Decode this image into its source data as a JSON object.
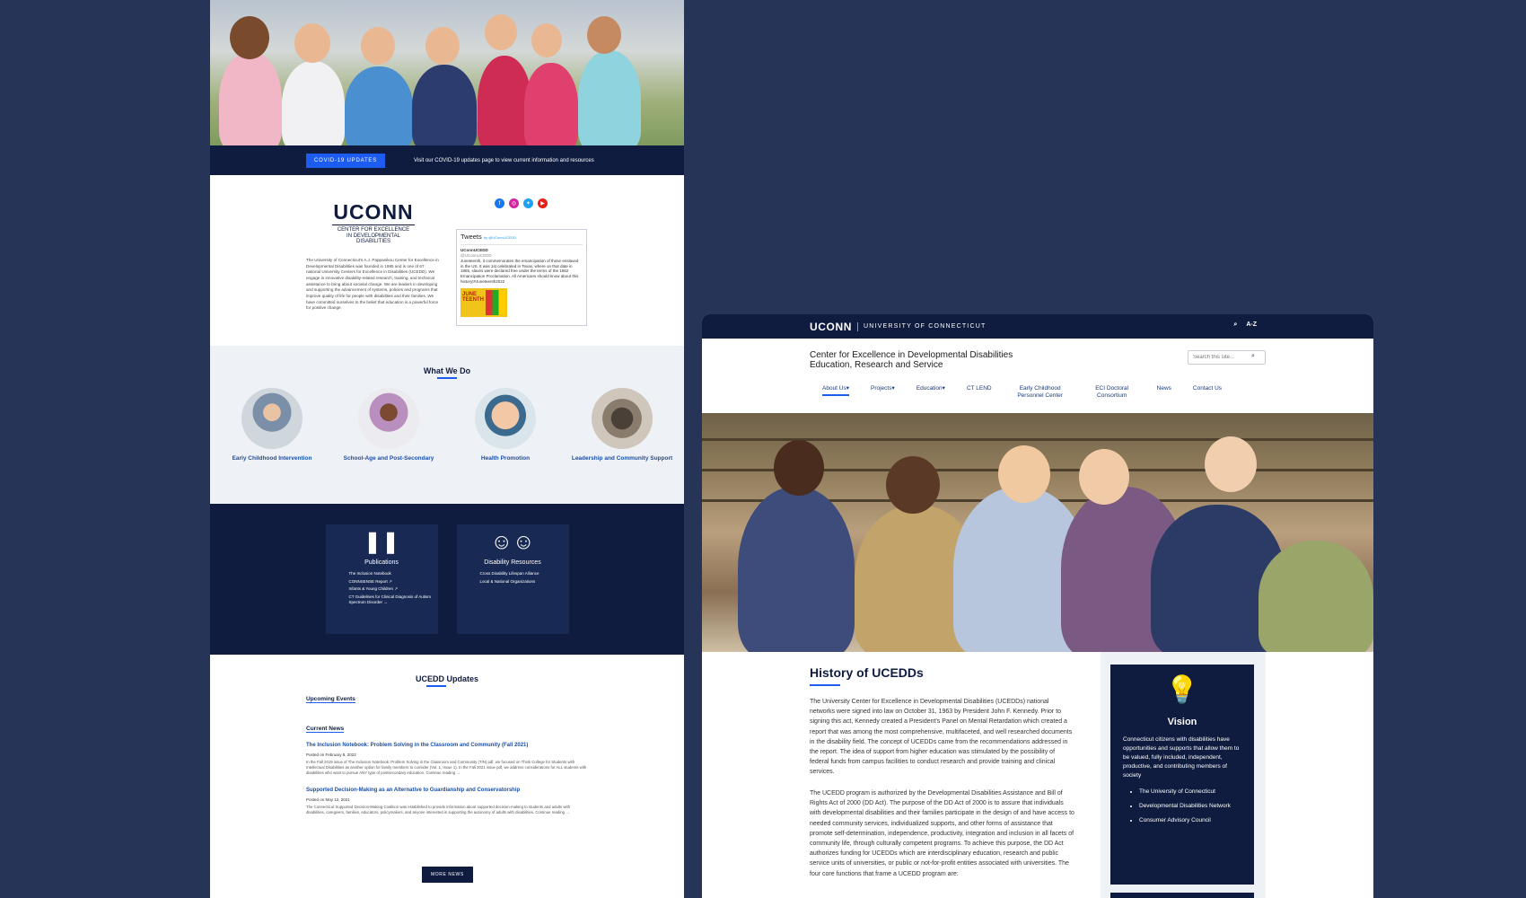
{
  "left_page": {
    "covid": {
      "button_label": "COVID-19 UPDATES",
      "text": "Visit our COVID-19 updates page to view current information and resources"
    },
    "logo": {
      "word": "UCONN",
      "subtitle_line1": "CENTER FOR EXCELLENCE",
      "subtitle_line2": "IN DEVELOPMENTAL",
      "subtitle_line3": "DISABILITIES"
    },
    "intro_text": "The University of Connecticut's A.J. Pappanikou Center for Excellence in Developmental Disabilities was founded in 1985 and is one of 67 national University Centers for Excellence in Disabilities (UCEDD). We engage in innovative disability-related research, training, and technical assistance to bring about societal change. We are leaders in developing and supporting the advancement of systems, policies and programs that improve quality of life for people with disabilities and their families. We have committed ourselves to the belief that education is a powerful force for positive change.",
    "social_icons": [
      "facebook-icon",
      "instagram-icon",
      "twitter-icon",
      "youtube-icon"
    ],
    "tweets": {
      "title": "Tweets",
      "by": "by @UConnUCEDD",
      "account": "UConnUCEDD",
      "handle": "@UConnUCEDD",
      "body": "Juneteenth, it commemorates the emancipation of those enslaved in the US. It was 1st celebrated in Texas, where on that date in 1865, slaves were declared free under the terms of the 1862 Emancipation Proclamation. All Americans should know about this history!#Juneteenth2022",
      "image_text": "JUNE TEENTH"
    },
    "what_we_do": {
      "title": "What We Do",
      "items": [
        {
          "label": "Early Childhood Intervention"
        },
        {
          "label": "School-Age and Post-Secondary"
        },
        {
          "label": "Health Promotion"
        },
        {
          "label": "Leadership and Community Support"
        }
      ]
    },
    "resources": [
      {
        "title": "Publications",
        "icon": "books-icon",
        "links": [
          "The Inclusion Notebook",
          "CONNSENSE Report ↗",
          "Infants & Young Children ↗",
          "CT Guidelines for Clinical Diagnosis of Autism Spectrum Disorder →"
        ]
      },
      {
        "title": "Disability Resources",
        "icon": "people-icon",
        "links": [
          "Cross Disability Lifespan Alliance",
          "Local & National Organizations"
        ]
      }
    ],
    "updates": {
      "title": "UCEDD Updates",
      "upcoming_label": "Upcoming Events",
      "current_label": "Current News",
      "news": [
        {
          "title": "The Inclusion Notebook: Problem Solving in the Classroom and Community (Fall 2021)",
          "date": "Posted on February 8, 2022",
          "body": "In the Fall 2019 issue of The Inclusion Notebook: Problem Solving in the Classroom and Community (TIN) pdf, we focused on Think College for Students with Intellectual Disabilities as another option for family members to consider (Vol. 1, Issue 1). In the Fall 2021 issue pdf, we address considerations for ALL students with disabilities who want to pursue ANY type of postsecondary education. Continue reading →"
        },
        {
          "title": "Supported Decision-Making as an Alternative to Guardianship and Conservatorship",
          "date": "Posted on May 12, 2021",
          "body": "The Connecticut Supported Decision-Making Coalition was established to provide information about supported decision-making to students and adults with disabilities, caregivers, families, educators, policymakers, and anyone interested in supporting the autonomy of adults with disabilities. Continue reading →"
        }
      ],
      "more_label": "MORE NEWS"
    }
  },
  "right_page": {
    "topbar": {
      "logo": "UCONN",
      "university": "UNIVERSITY OF CONNECTICUT",
      "search_icon": "search-icon",
      "az_label": "A-Z"
    },
    "site_title_line1": "Center for Excellence in Developmental Disabilities",
    "site_title_line2": "Education, Research and Service",
    "search_placeholder": "Search this site...",
    "nav": [
      {
        "label": "About Us▾",
        "active": true
      },
      {
        "label": "Projects▾"
      },
      {
        "label": "Education▾"
      },
      {
        "label": "CT LEND"
      },
      {
        "label": "Early Childhood Personnel Center"
      },
      {
        "label": "ECI Doctoral Consortium"
      },
      {
        "label": "News"
      },
      {
        "label": "Contact Us"
      }
    ],
    "history": {
      "title": "History of UCEDDs",
      "p1": "The University Center for Excellence in Developmental Disabilities (UCEDDs) national networks were signed into law on October 31, 1963 by President John F. Kennedy. Prior to signing this act, Kennedy created a President's Panel on Mental Retardation which created a report that was among the most comprehensive, multifaceted, and well researched documents in the disability field. The concept of UCEDDs came from the recommendations addressed in the report. The idea of support from higher education was stimulated by the possibility of federal funds from campus facilities to conduct research and provide training and clinical services.",
      "p2": "The UCEDD program is authorized by the Developmental Disabilities Assistance and Bill of Rights Act of 2000 (DD Act). The purpose of the DD Act of 2000 is to assure that individuals with developmental disabilities and their families participate in the design of and have access to needed community services, individualized supports, and other forms of assistance that promote self-determination, independence, productivity, integration and inclusion in all facets of community life, through culturally competent programs. To achieve this purpose, the DD Act authorizes funding for UCEDDs which are interdisciplinary education, research and public service units of universities, or public or not-for-profit entities associated with universities. The four core functions that frame a UCEDD program are:"
    },
    "vision": {
      "icon": "lightbulb-icon",
      "title": "Vision",
      "text": "Connecticut citizens with disabilities have opportunities and supports that allow them to be valued, fully included, independent, productive, and contributing members of society",
      "list": [
        "The University of Connecticut",
        "Developmental Disabilities Network",
        "Consumer Advisory Council"
      ]
    }
  }
}
